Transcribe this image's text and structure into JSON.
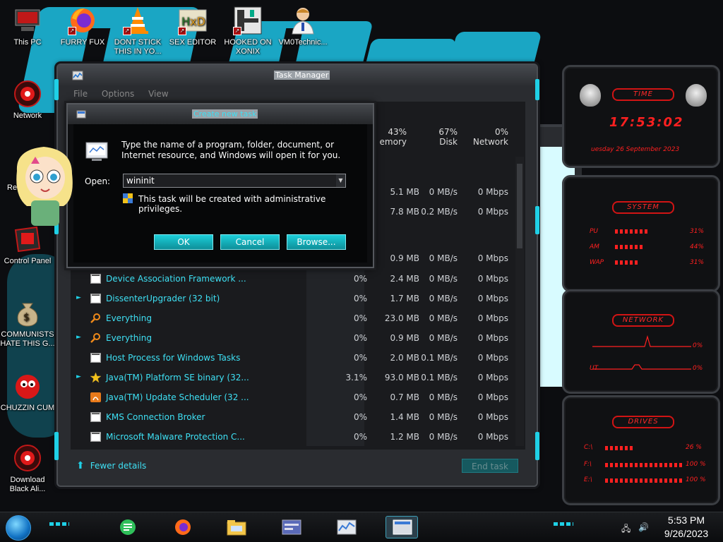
{
  "desktop": {
    "icons": [
      {
        "label": "This PC"
      },
      {
        "label": "FURRY FUX"
      },
      {
        "label": "DONT STICK THIS IN YO..."
      },
      {
        "label": "SEX EDITOR"
      },
      {
        "label": "HOOKED ON XONIX"
      },
      {
        "label": "VM0Technic..."
      },
      {
        "label": "Network"
      },
      {
        "label": "Recy"
      },
      {
        "label": "Control Panel"
      },
      {
        "label": "COMMUNISTS HATE THIS G..."
      },
      {
        "label": "CHUZZIN CUM"
      },
      {
        "label": "Download Black Ali..."
      }
    ]
  },
  "task_manager": {
    "title": "Task Manager",
    "menu": [
      "File",
      "Options",
      "View"
    ],
    "columns": {
      "memory": {
        "pct": "43%",
        "label": "emory"
      },
      "disk": {
        "pct": "67%",
        "label": "Disk"
      },
      "network": {
        "pct": "0%",
        "label": "Network"
      }
    },
    "partial_rows": [
      {
        "memory": "5.1 MB",
        "disk": "0 MB/s",
        "network": "0 Mbps"
      },
      {
        "memory": "7.8 MB",
        "disk": "0.2 MB/s",
        "network": "0 Mbps"
      },
      {
        "memory": "0.9 MB",
        "disk": "0 MB/s",
        "network": "0 Mbps"
      }
    ],
    "processes": [
      {
        "name": "Device Association Framework ...",
        "cpu": "0%",
        "memory": "2.4 MB",
        "disk": "0 MB/s",
        "network": "0 Mbps",
        "icon": "window-icon",
        "expandable": false
      },
      {
        "name": "DissenterUpgrader (32 bit)",
        "cpu": "0%",
        "memory": "1.7 MB",
        "disk": "0 MB/s",
        "network": "0 Mbps",
        "icon": "window-icon",
        "expandable": true
      },
      {
        "name": "Everything",
        "cpu": "0%",
        "memory": "23.0 MB",
        "disk": "0 MB/s",
        "network": "0 Mbps",
        "icon": "magnifier-icon",
        "expandable": false
      },
      {
        "name": "Everything",
        "cpu": "0%",
        "memory": "0.9 MB",
        "disk": "0 MB/s",
        "network": "0 Mbps",
        "icon": "magnifier-icon",
        "expandable": true
      },
      {
        "name": "Host Process for Windows Tasks",
        "cpu": "0%",
        "memory": "2.0 MB",
        "disk": "0.1 MB/s",
        "network": "0 Mbps",
        "icon": "window-icon",
        "expandable": false
      },
      {
        "name": "Java(TM) Platform SE binary (32...",
        "cpu": "3.1%",
        "memory": "93.0 MB",
        "disk": "0.1 MB/s",
        "network": "0 Mbps",
        "icon": "java-icon",
        "expandable": true
      },
      {
        "name": "Java(TM) Update Scheduler (32 ...",
        "cpu": "0%",
        "memory": "0.7 MB",
        "disk": "0 MB/s",
        "network": "0 Mbps",
        "icon": "java-update-icon",
        "expandable": false
      },
      {
        "name": "KMS Connection Broker",
        "cpu": "0%",
        "memory": "1.4 MB",
        "disk": "0 MB/s",
        "network": "0 Mbps",
        "icon": "window-icon",
        "expandable": false
      },
      {
        "name": "Microsoft Malware Protection C...",
        "cpu": "0%",
        "memory": "1.2 MB",
        "disk": "0 MB/s",
        "network": "0 Mbps",
        "icon": "window-icon",
        "expandable": false
      }
    ],
    "fewer_details": "Fewer details",
    "end_task": "End task"
  },
  "run_dialog": {
    "title": "Create new task",
    "description": "Type the name of a program, folder, document, or Internet resource, and Windows will open it for you.",
    "open_label": "Open:",
    "open_value": "wininit",
    "admin_note": "This task will be created with administrative privileges.",
    "ok": "OK",
    "cancel": "Cancel",
    "browse": "Browse..."
  },
  "gadgets": {
    "time": {
      "title": "TIME",
      "clock": "17:53:02",
      "date": "uesday 26 September 2023"
    },
    "system": {
      "title": "SYSTEM",
      "cpu_label": "PU",
      "cpu_val": "31%",
      "ram_label": "AM",
      "ram_val": "44%",
      "swap_label": "WAP",
      "swap_val": "31%"
    },
    "network": {
      "title": "NETWORK",
      "in_val": "0%",
      "out_label": "UT",
      "out_val": "0%"
    },
    "drives": {
      "title": "DRIVES",
      "d1_label": "C:\\",
      "d1_val": "26 %",
      "d2_label": "F:\\",
      "d2_val": "100 %",
      "d3_label": "E:\\",
      "d3_val": "100 %"
    }
  },
  "taskbar": {
    "time": "5:53 PM",
    "date": "9/26/2023"
  },
  "colors": {
    "accent_cyan": "#1fd0e6",
    "process_text": "#3ee0f4",
    "gadget_red": "#ff2020"
  }
}
